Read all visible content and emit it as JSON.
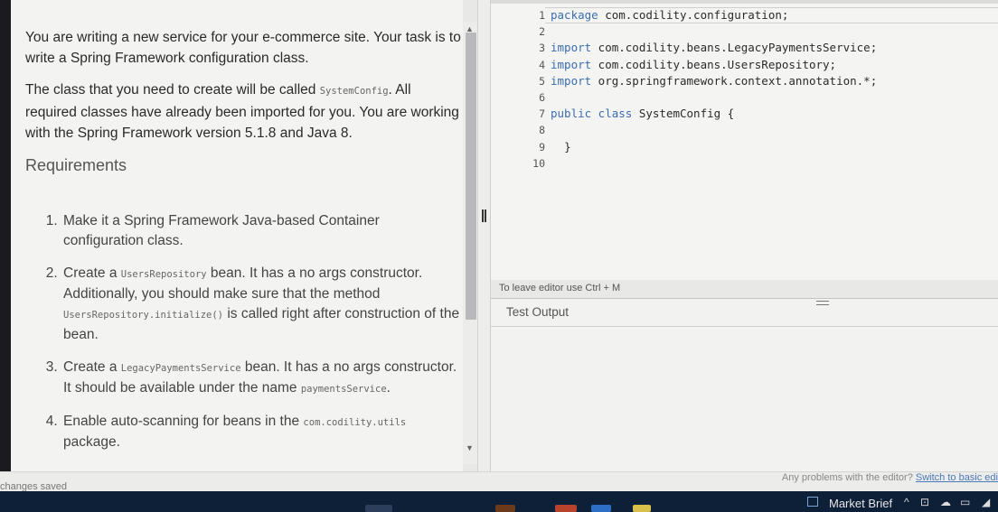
{
  "task": {
    "intro_p1": "You are writing a new service for your e-commerce site. Your task is to write a Spring Framework configuration class.",
    "intro_p2_a": "The class that you need to create will be called ",
    "intro_p2_code": "SystemConfig",
    "intro_p2_b": ". All required classes have already been imported for you. You are working with the Spring Framework version 5.1.8 and Java 8.",
    "requirements_heading": "Requirements",
    "req1": "Make it a Spring Framework Java-based Container configuration class.",
    "req2_a": "Create a ",
    "req2_code1": "UsersRepository",
    "req2_b": " bean. It has a no args constructor. Additionally, you should make sure that the method ",
    "req2_code2": "UsersRepository.initialize()",
    "req2_c": " is called right after construction of the bean.",
    "req3_a": "Create a ",
    "req3_code1": "LegacyPaymentsService",
    "req3_b": " bean. It has a no args constructor. It should be available under the name ",
    "req3_code2": "paymentsService",
    "req3_c": ".",
    "req4_a": "Enable auto-scanning for beans in the ",
    "req4_code": "com.codility.utils",
    "req4_b": " package."
  },
  "editor": {
    "line_numbers": [
      "1",
      "2",
      "3",
      "4",
      "5",
      "6",
      "7",
      "8",
      "9",
      "10"
    ],
    "l1_kw": "package",
    "l1_rest": " com.codility.configuration;",
    "l3_kw": "import",
    "l3_rest": " com.codility.beans.LegacyPaymentsService;",
    "l4_kw": "import",
    "l4_rest": " com.codility.beans.UsersRepository;",
    "l5_kw": "import",
    "l5_rest": " org.springframework.context.annotation.*;",
    "l7_kw": "public class",
    "l7_rest": " SystemConfig {",
    "l9": "}",
    "hint": "To leave editor use Ctrl + M"
  },
  "output": {
    "tab_label": "Test Output"
  },
  "status": {
    "saved": "changes saved",
    "problems": "Any problems with the editor? ",
    "switch_link": "Switch to basic edi"
  },
  "taskbar": {
    "news_label": "Market Brief"
  },
  "colors": {
    "keyword": "#3a6db0",
    "taskbar": "#0e1f38",
    "link": "#4a78b8"
  }
}
